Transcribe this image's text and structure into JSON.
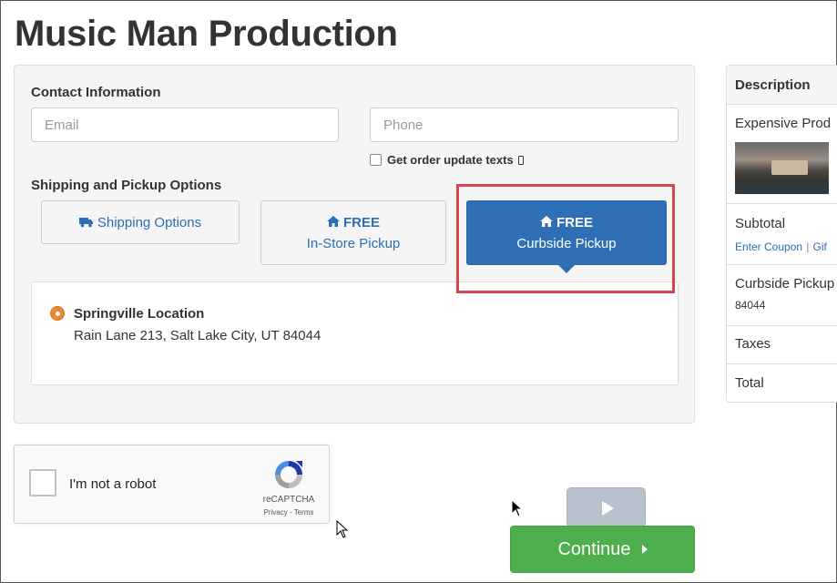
{
  "page": {
    "title": "Music Man Production"
  },
  "contact": {
    "heading": "Contact Information",
    "email_placeholder": "Email",
    "phone_placeholder": "Phone",
    "sms_optin_label": "Get order update texts"
  },
  "shipping": {
    "heading": "Shipping and Pickup Options",
    "options": [
      {
        "bold": "",
        "label": "Shipping Options",
        "icon": "truck-icon",
        "selected": false
      },
      {
        "bold": "FREE",
        "label": "In-Store Pickup",
        "icon": "home-icon",
        "selected": false
      },
      {
        "bold": "FREE",
        "label": "Curbside Pickup",
        "icon": "home-icon",
        "selected": true
      }
    ],
    "location": {
      "name": "Springville Location",
      "address": "Rain Lane 213, Salt Lake City, UT 84044"
    }
  },
  "summary": {
    "header": "Description",
    "product_name": "Expensive Prod",
    "subtotal_label": "Subtotal",
    "coupon_link": "Enter Coupon",
    "separator": "|",
    "gift_link": "Gif",
    "curbside_label": "Curbside Pickup",
    "curbside_zip": "84044",
    "taxes_label": "Taxes",
    "total_label": "Total"
  },
  "recaptcha": {
    "label": "I'm not a robot",
    "brand": "reCAPTCHA",
    "terms": "Privacy - Terms"
  },
  "actions": {
    "continue_label": "Continue"
  },
  "colors": {
    "primary": "#2f6fb6",
    "success": "#4cae4c",
    "highlight": "#d9454f",
    "radio": "#e8892f"
  }
}
